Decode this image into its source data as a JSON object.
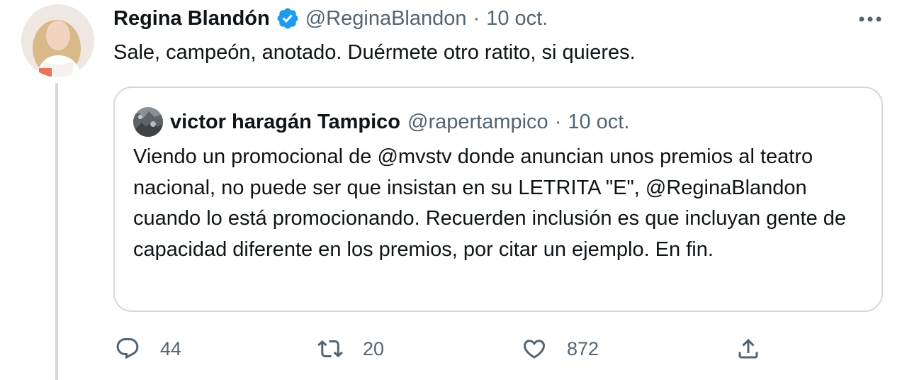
{
  "tweet": {
    "author": {
      "display_name": "Regina Blandón",
      "handle": "@ReginaBlandon",
      "verified": true
    },
    "separator": "·",
    "date": "10 oct.",
    "text": "Sale, campeón, anotado. Duérmete otro ratito, si quieres.",
    "more_icon": "more-horizontal-icon"
  },
  "quoted_tweet": {
    "author": {
      "display_name": "victor haragán Tampico",
      "handle": "@rapertampico"
    },
    "separator": "·",
    "date": "10 oct.",
    "text": "Viendo un promocional de @mvstv donde anuncian unos premios al teatro nacional, no puede ser que insistan en su LETRITA \"E\", @ReginaBlandon cuando lo está promocionando. Recuerden inclusión es que incluyan gente de capacidad diferente en los premios, por citar un ejemplo. En fin."
  },
  "actions": {
    "reply": {
      "icon": "reply-icon",
      "count": "44"
    },
    "retweet": {
      "icon": "retweet-icon",
      "count": "20"
    },
    "like": {
      "icon": "heart-icon",
      "count": "872"
    },
    "share": {
      "icon": "share-icon"
    }
  },
  "colors": {
    "text": "#0f1419",
    "muted": "#536471",
    "verified_blue": "#1d9bf0",
    "border": "#cfd9de"
  }
}
